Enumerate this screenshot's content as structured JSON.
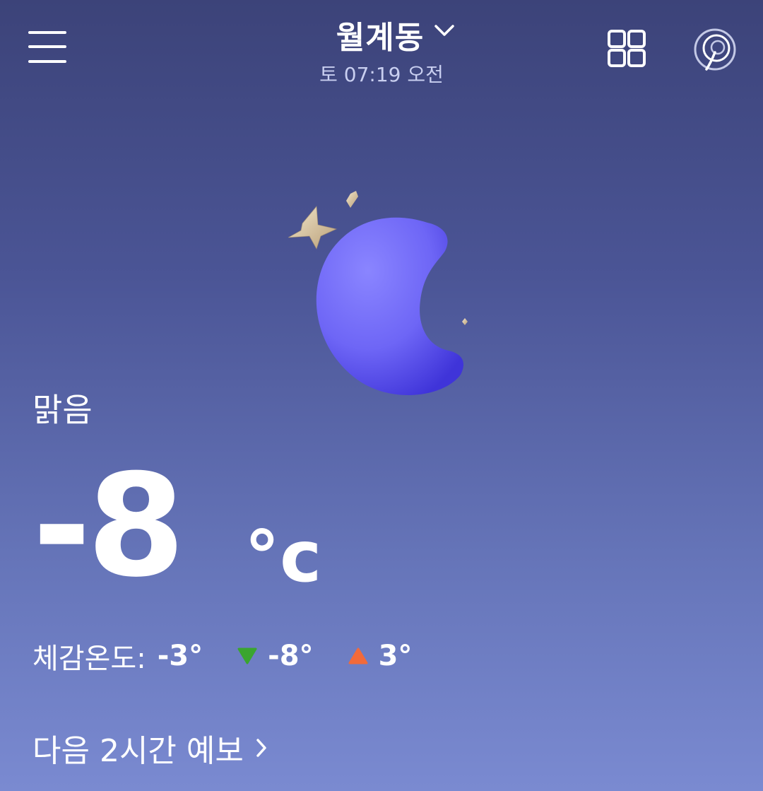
{
  "header": {
    "location": "월계동",
    "datetime": "토 07:19 오전",
    "icons": {
      "menu": "hamburger-menu-icon",
      "location_dropdown": "chevron-down-icon",
      "widgets": "grid-icon",
      "provider": "provider-logo-icon"
    }
  },
  "current": {
    "condition": "맑음",
    "illustration": "crescent-moon-with-stars",
    "temperature": "-8",
    "unit": "°c",
    "feels_like_label": "체감온도:",
    "feels_like_value": "-3°",
    "min_temp": "-8°",
    "max_temp": "3°",
    "min_indicator_color": "#3aa52f",
    "max_indicator_color": "#f26a3a"
  },
  "forecast_link": {
    "label": "다음 2시간 예보"
  },
  "colors": {
    "background_top": "#3c4379",
    "background_bottom": "#7a8ad1",
    "moon": "#6a63f2",
    "stars": "#d9c9a6"
  }
}
